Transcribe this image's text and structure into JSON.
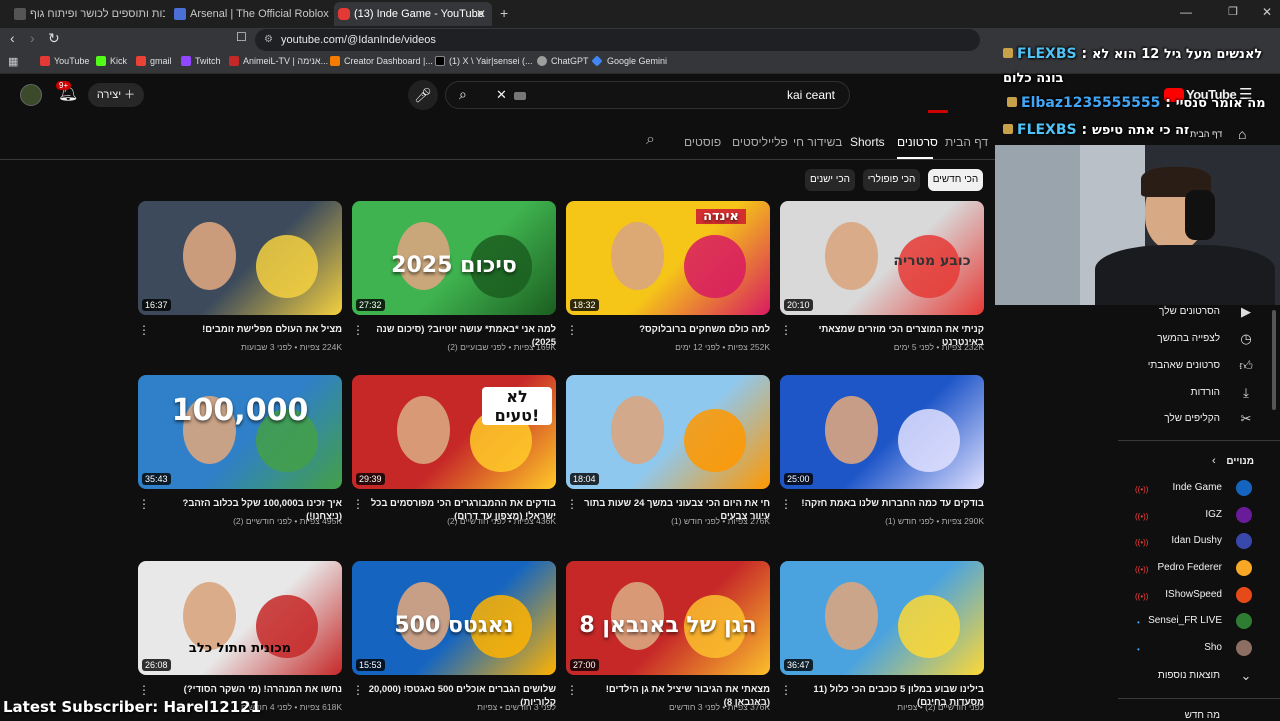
{
  "browser": {
    "tabs": [
      {
        "title": "מוצרי איכות ותוספים לכושר ופיתוח גוף"
      },
      {
        "title": "Arsenal | The Official Roblox Website"
      },
      {
        "title": "(13) Inde Game - YouTube"
      }
    ],
    "url": "youtube.com/@IdanInde/videos",
    "bookmarks": [
      "YouTube",
      "Kick",
      "gmail",
      "Twitch",
      "AnimeiL-TV | אנימה...",
      "Creator Dashboard |...",
      "(1) X \\ Yair|sensei (...",
      "ChatGPT",
      "Google Gemini"
    ]
  },
  "yt": {
    "create_label": "יצירה",
    "notif_count": "9+",
    "search_value": "kai ceant",
    "logo_text": "YouTube",
    "home_label": "דף הבית"
  },
  "channel_tabs": [
    "דף הבית",
    "סרטונים",
    "Shorts",
    "בשידור חי",
    "פלייליסטים",
    "פוסטים"
  ],
  "chips": [
    "הכי חדשים",
    "הכי פופולרי",
    "הכי ישנים"
  ],
  "videos": [
    {
      "title": "קניתי את המוצרים הכי מוזרים שמצאתי באינטרנט",
      "meta": "232K צפיות • לפני 5 ימים",
      "duration": "20:10",
      "thumb_text": "כובע מטריה",
      "color": "#d9d9d9",
      "accent": "#e53935"
    },
    {
      "title": "למה כולם משחקים ברובלוקס?",
      "meta": "252K צפיות • לפני 12 ימים",
      "duration": "18:32",
      "thumb_text": "אינדה",
      "color": "#f5c518",
      "accent": "#d81b60"
    },
    {
      "title": "למה אני *באמת* עושה יוטיוב? (סיכום שנה 2025)",
      "meta": "169K צפיות • לפני שבועיים (2)",
      "duration": "27:32",
      "thumb_text": "סיכום 2025",
      "color": "#3fb34f",
      "accent": "#1b5e20"
    },
    {
      "title": "מציל את העולם מפלישת זומבים!",
      "meta": "224K צפיות • לפני 3 שבועות",
      "duration": "16:37",
      "thumb_text": "",
      "color": "#3c4a5c",
      "accent": "#f4d03f"
    },
    {
      "title": "בודקים עד כמה החברות שלנו באמת חזקה!",
      "meta": "290K צפיות • לפני חודש (1)",
      "duration": "25:00",
      "thumb_text": "",
      "color": "#1e56c8",
      "accent": "#e0e0ff"
    },
    {
      "title": "חי את היום הכי צבעוני במשך 24 שעות בתור עיוור צבעים",
      "meta": "276K צפיות • לפני חודש (1)",
      "duration": "18:04",
      "thumb_text": "",
      "color": "#8fc8ee",
      "accent": "#ff9800"
    },
    {
      "title": "בודקים את ההמבורגרים הכי מפורסמים בכל ישראל! (מצפון עד דרום)",
      "meta": "436K צפיות • לפני חודשיים (2)",
      "duration": "29:39",
      "thumb_text": "לא טעים!",
      "color": "#c62828",
      "accent": "#ffca28"
    },
    {
      "title": "איך זכינו ב100,000 שקל בכלוב הזהב? (ניצחנו!)",
      "meta": "495K צפיות • לפני חודשיים (2)",
      "duration": "35:43",
      "thumb_text": "100,000",
      "color": "#2f80c8",
      "accent": "#43a047"
    },
    {
      "title": "בילינו שבוע במלון 5 כוכבים הכי כלול (11 מסעדות בחינם)",
      "meta": "לפני חודשיים (2) • צפיות",
      "duration": "36:47",
      "thumb_text": "",
      "color": "#4aa3df",
      "accent": "#fdd835"
    },
    {
      "title": "מצאתי את הגיבור שיציל את גן הילדים! (באנבאן 8)",
      "meta": "376K צפיות • לפני 3 חודשים",
      "duration": "27:00",
      "thumb_text": "הגן של באנבאן 8",
      "color": "#c62828",
      "accent": "#fbc02d"
    },
    {
      "title": "שלושים הגברים אוכלים 500 נאגטס! (20,000 קלוריות)",
      "meta": "לפני 3 חודשים • צפיות",
      "duration": "15:53",
      "thumb_text": "500 נאגטס",
      "color": "#1565c0",
      "accent": "#ffb300"
    },
    {
      "title": "נחשו את המנהרה! (מי השקר הסודי?)",
      "meta": "618K צפיות • לפני 4 חודשים",
      "duration": "26:08",
      "thumb_text": "מכונית חתול כלב",
      "color": "#e8e8e8",
      "accent": "#c62828"
    }
  ],
  "sidebar": {
    "you_items": [
      "הסרטונים שלך",
      "לצפייה בהמשך",
      "סרטונים שאהבתי",
      "הורדות",
      "הקליפים שלך"
    ],
    "subs_header": "מנויים",
    "subs": [
      {
        "name": "Inde Game",
        "live": true,
        "color": "#1565c0"
      },
      {
        "name": "IGZ",
        "live": true,
        "color": "#6a1b9a"
      },
      {
        "name": "Idan Dushy",
        "live": true,
        "color": "#3949ab"
      },
      {
        "name": "Pedro Federer",
        "live": true,
        "color": "#f9a825"
      },
      {
        "name": "IShowSpeed",
        "live": true,
        "color": "#e64a19"
      },
      {
        "name": "Sensei_FR LIVE",
        "live": false,
        "color": "#2e7d32"
      },
      {
        "name": "Sho",
        "live": false,
        "color": "#8d6e63"
      }
    ],
    "show_more": "תוצאות נוספות",
    "bottom_label": "מה חדש"
  },
  "overlay": {
    "chat": [
      {
        "user": "FLEXBS",
        "msg": "לאנשים מעל גיל 12 הוא לא בונה כלום",
        "color": "#4fc3f7"
      },
      {
        "user": "Elbaz1235555555",
        "msg": "מה אומר סנסיי",
        "color": "#42a5f5"
      },
      {
        "user": "FLEXBS",
        "msg": "זה כי אתה טיפש",
        "color": "#4fc3f7"
      }
    ],
    "latest_subscriber": "Latest Subscriber: Harel12121"
  }
}
